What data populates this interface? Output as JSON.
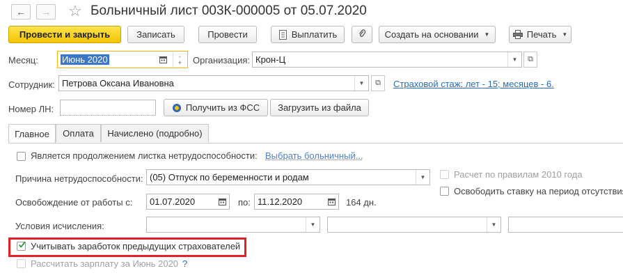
{
  "header": {
    "title": "Больничный лист 003К-000005 от 05.07.2020",
    "back_icon": "arrow-left-icon",
    "forward_icon": "arrow-right-icon",
    "favorite_icon": "star-icon"
  },
  "toolbar": {
    "post_close_label": "Провести и закрыть",
    "save_label": "Записать",
    "post_label": "Провести",
    "pay_label": "Выплатить",
    "create_based_label": "Создать на основании",
    "print_label": "Печать"
  },
  "form": {
    "month_label": "Месяц:",
    "month_value": "Июнь 2020",
    "org_label": "Организация:",
    "org_value": "Крон-Ц",
    "employee_label": "Сотрудник:",
    "employee_value": "Петрова Оксана Ивановна",
    "insurance_link": "Страховой стаж: лет - 15; месяцев - 6.",
    "ln_label": "Номер ЛН:",
    "ln_value": "",
    "get_fss_label": "Получить из ФСС",
    "load_file_label": "Загрузить из файла"
  },
  "tabs": [
    {
      "label": "Главное",
      "active": true
    },
    {
      "label": "Оплата",
      "active": false
    },
    {
      "label": "Начислено (подробно)",
      "active": false
    }
  ],
  "main": {
    "continuation_label": "Является продолжением листка нетрудоспособности:",
    "continuation_checked": false,
    "choose_sick_link": "Выбрать больничный...",
    "reason_label": "Причина нетрудоспособности:",
    "reason_value": "(05) Отпуск по беременности и родам",
    "rules_2010_label": "Расчет по правилам 2010 года",
    "rules_2010_checked": false,
    "free_rate_label": "Освободить ставку на период отсутствия",
    "free_rate_checked": false,
    "release_label": "Освобождение от работы с:",
    "release_from": "01.07.2020",
    "release_to_label": "по:",
    "release_to": "11.12.2020",
    "days_text": "164 дн.",
    "conditions_label": "Условия исчисления:",
    "conditions_1": "",
    "conditions_2": "",
    "conditions_3": "",
    "prev_insurers_label": "Учитывать заработок предыдущих страхователей",
    "prev_insurers_checked": true,
    "calc_salary_label": "Рассчитать зарплату за Июнь 2020",
    "calc_salary_checked": false,
    "help_mark": "?"
  },
  "colors": {
    "primary_button": "#f5c400",
    "highlight_border": "#e0202a",
    "link": "#2a6bb8",
    "check_green": "#2e9d3a"
  }
}
